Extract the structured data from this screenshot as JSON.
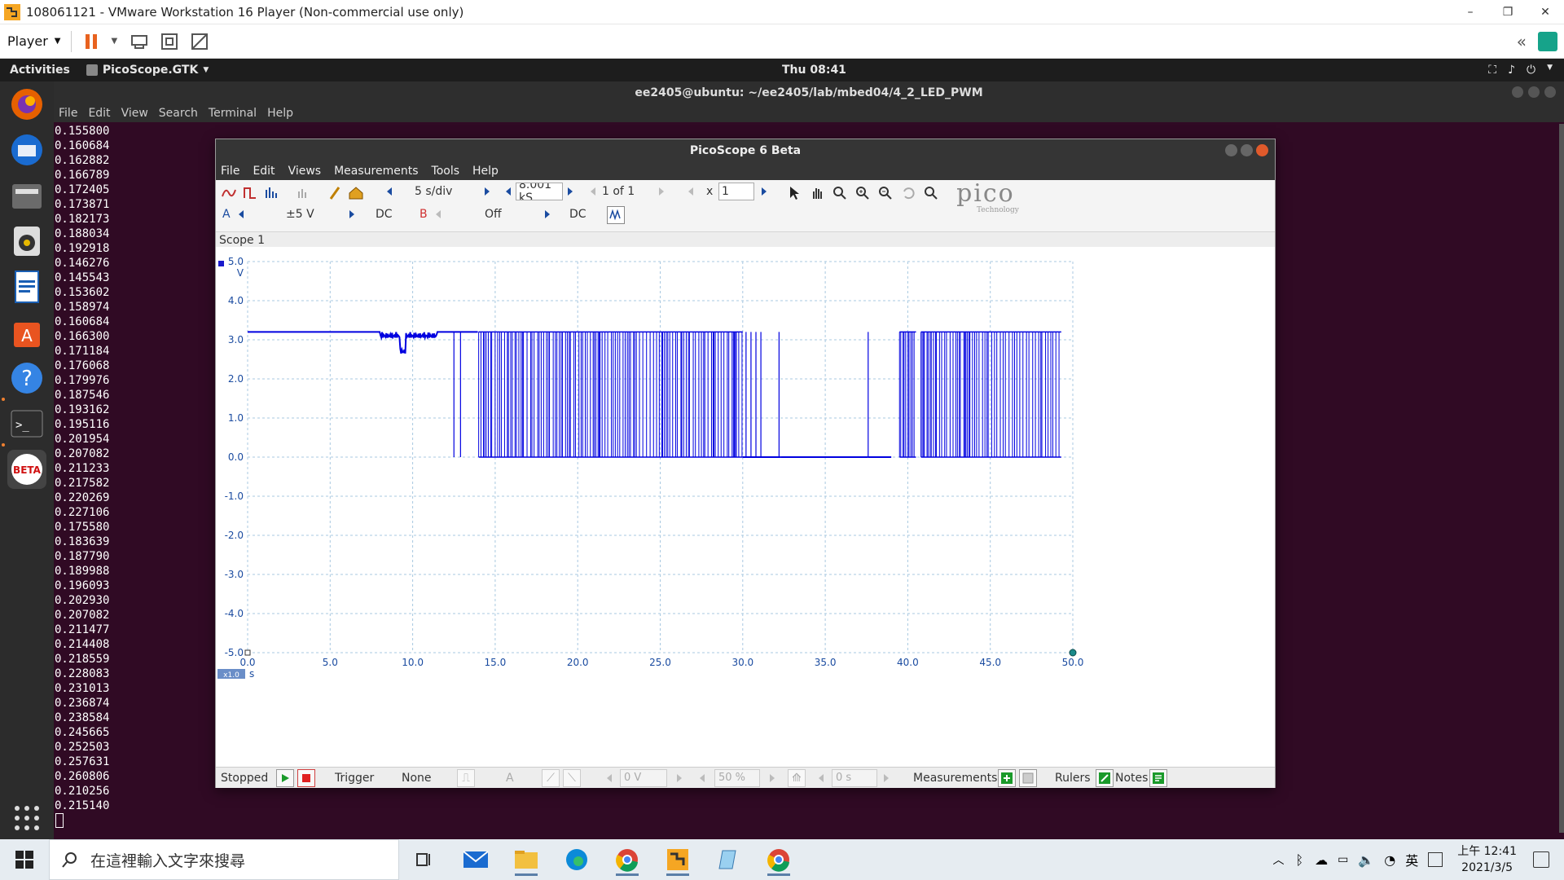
{
  "vmware": {
    "title": "108061121 - VMware Workstation 16 Player (Non-commercial use only)",
    "player_menu": "Player",
    "window_controls": {
      "minimize": "–",
      "restore": "❐",
      "close": "✕"
    },
    "right_collapse": "«"
  },
  "gnome": {
    "activities": "Activities",
    "app_menu": "PicoScope.GTK",
    "clock": "Thu 08:41"
  },
  "terminal": {
    "title": "ee2405@ubuntu: ~/ee2405/lab/mbed04/4_2_LED_PWM",
    "menu": [
      "File",
      "Edit",
      "View",
      "Search",
      "Terminal",
      "Help"
    ],
    "lines": [
      "0.155800",
      "0.160684",
      "0.162882",
      "0.166789",
      "0.172405",
      "0.173871",
      "0.182173",
      "0.188034",
      "0.192918",
      "0.146276",
      "0.145543",
      "0.153602",
      "0.158974",
      "0.160684",
      "0.166300",
      "0.171184",
      "0.176068",
      "0.179976",
      "0.187546",
      "0.193162",
      "0.195116",
      "0.201954",
      "0.207082",
      "0.211233",
      "0.217582",
      "0.220269",
      "0.227106",
      "0.175580",
      "0.183639",
      "0.187790",
      "0.189988",
      "0.196093",
      "0.202930",
      "0.207082",
      "0.211477",
      "0.214408",
      "0.218559",
      "0.228083",
      "0.231013",
      "0.236874",
      "0.238584",
      "0.245665",
      "0.252503",
      "0.257631",
      "0.260806",
      "0.210256",
      "0.215140"
    ]
  },
  "pico": {
    "title": "PicoScope 6 Beta",
    "menu": [
      "File",
      "Edit",
      "Views",
      "Measurements",
      "Tools",
      "Help"
    ],
    "timebase": "5 s/div",
    "samples": "8.001 kS",
    "capture_nav": "1 of 1",
    "zoom_x_label": "x",
    "zoom_value": "1",
    "channel_a": {
      "label": "A",
      "range": "±5 V",
      "coupling": "DC",
      "color": "#1a4ba0"
    },
    "channel_b": {
      "label": "B",
      "range": "Off",
      "coupling": "DC",
      "color": "#d03030"
    },
    "logo": "pico",
    "logo_sub": "Technology",
    "scope_label": "Scope 1",
    "y_unit": "V",
    "x_unit": "s",
    "x_zoom_badge": "x1.0",
    "status": {
      "state": "Stopped",
      "trigger_label": "Trigger",
      "trigger_mode": "None",
      "trigger_channel": "A",
      "threshold": "0 V",
      "pretrigger": "50 %",
      "delay": "0 s",
      "measurements": "Measurements",
      "rulers": "Rulers",
      "notes": "Notes"
    }
  },
  "chart_data": {
    "type": "line",
    "title": "",
    "xlabel": "s",
    "ylabel": "V",
    "xlim": [
      0,
      50
    ],
    "ylim": [
      -5,
      5
    ],
    "x_ticks": [
      "0.0",
      "5.0",
      "10.0",
      "15.0",
      "20.0",
      "25.0",
      "30.0",
      "35.0",
      "40.0",
      "45.0",
      "50.0"
    ],
    "y_ticks": [
      "5.0",
      "4.0",
      "3.0",
      "2.0",
      "1.0",
      "0.0",
      "-1.0",
      "-2.0",
      "-3.0",
      "-4.0",
      "-5.0"
    ],
    "grid": true,
    "series": [
      {
        "color": "#0000e0",
        "high_level": 3.2,
        "low_level": 0.0,
        "dense_pwm_ranges": [
          [
            14.0,
            30.0
          ],
          [
            39.5,
            40.5
          ],
          [
            40.8,
            49.3
          ]
        ],
        "sparse_pulses": [
          12.5,
          12.9,
          30.2,
          30.5,
          30.8,
          31.1,
          32.2,
          37.6
        ],
        "low_ranges": [
          [
            30.0,
            32.3
          ],
          [
            32.3,
            37.6
          ],
          [
            37.6,
            39.0
          ]
        ],
        "noise_segment": [
          8.0,
          11.5
        ],
        "noise_min": 2.8,
        "end": 49.3
      }
    ]
  },
  "taskbar": {
    "search_placeholder": "在這裡輸入文字來搜尋",
    "ime": "英",
    "time": "上午 12:41",
    "date": "2021/3/5"
  }
}
